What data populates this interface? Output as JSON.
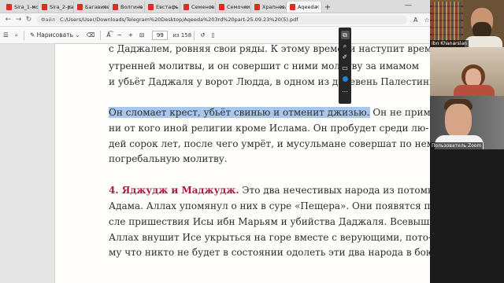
{
  "tabs": [
    {
      "label": "Sira_1-мо",
      "active": false
    },
    {
      "label": "Sira_2-ра",
      "active": false
    },
    {
      "label": "Багавиев",
      "active": false
    },
    {
      "label": "Волгина",
      "active": false
    },
    {
      "label": "Евстафь",
      "active": false
    },
    {
      "label": "Семенов",
      "active": false
    },
    {
      "label": "Семочкин",
      "active": false
    },
    {
      "label": "Храпнева",
      "active": false
    },
    {
      "label": "Aqeeda",
      "active": true
    }
  ],
  "address": {
    "label": "Файл",
    "url": "C:/Users/User/Downloads/Telegram%20Desktop/Aqeeda%203rd%20part-25.09.23%20(5).pdf"
  },
  "toolbar": {
    "draw_label": "Нарисовать",
    "current_page": "99",
    "total_pages": "из 158"
  },
  "document": {
    "lines": [
      {
        "text": "с Даджалем, ровняя свои ряды. К этому времени наступит время"
      },
      {
        "text": "утренней молитвы, и он совершит с ними молитву за имамом"
      },
      {
        "text": "и убьёт Даджаля у ворот Людда, в одном из деревень Палестины."
      },
      {
        "highlight": "Он сломает крест, убьёт свинью и отменит джизью.",
        "text": " Он не примет"
      },
      {
        "text": "ни от кого иной религии кроме Ислама. Он пробудет среди лю-"
      },
      {
        "text": "дей сорок лет, после чего умрёт, и мусульмане совершат по нему"
      },
      {
        "text": "погребальную молитву."
      },
      {
        "heading": "4. Яджудж и Маджудж.",
        "text": " Это два нечестивых народа из потомков"
      },
      {
        "text": "Адама. Аллах упомянул о них в суре «Пещера». Они появятся по-"
      },
      {
        "text": "сле пришествия Исы ибн Марьям и убийства Даджаля. Всевышний"
      },
      {
        "text": "Аллах внушит Исе укрыться на горе вместе с верующими, пото-"
      },
      {
        "text": "му что никто не будет в состоянии одолеть эти два народа в бою."
      }
    ]
  },
  "participants": [
    {
      "name": "Ibn Khanarslan"
    },
    {
      "name": ""
    },
    {
      "name": "Пользователь Zoom"
    }
  ]
}
